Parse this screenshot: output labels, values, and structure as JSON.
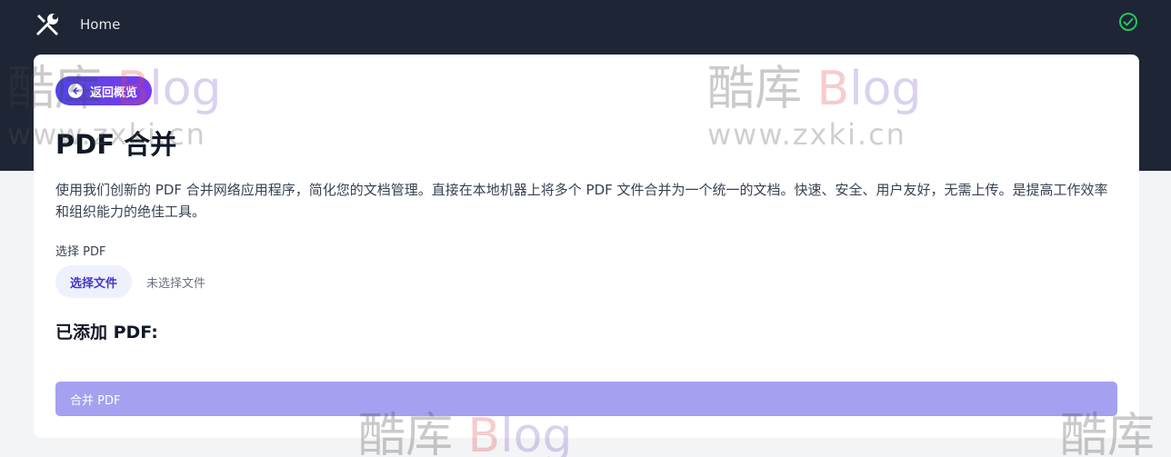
{
  "header": {
    "home_label": "Home"
  },
  "card": {
    "back_label": "返回概览",
    "title": "PDF 合并",
    "description": "使用我们创新的 PDF 合并网络应用程序，简化您的文档管理。直接在本地机器上将多个 PDF 文件合并为一个统一的文档。快速、安全、用户友好，无需上传。是提高工作效率和组织能力的绝佳工具。",
    "select_label": "选择 PDF",
    "choose_file_label": "选择文件",
    "no_file_label": "未选择文件",
    "added_title": "已添加 PDF:",
    "merge_label": "合并 PDF"
  },
  "watermark": {
    "brand_cn": "酷库",
    "brand_b": "B",
    "brand_rest": "log",
    "url": "www.zxki.cn"
  },
  "colors": {
    "topbar": "#1e2535",
    "accent_start": "#4f46e5",
    "accent_end": "#7c3aed",
    "merge_button": "#a5a0f0",
    "status_ok": "#22c55e"
  },
  "icons": {
    "logo": "tools-icon",
    "status": "check-circle-icon",
    "back": "arrow-left-circle-icon"
  }
}
